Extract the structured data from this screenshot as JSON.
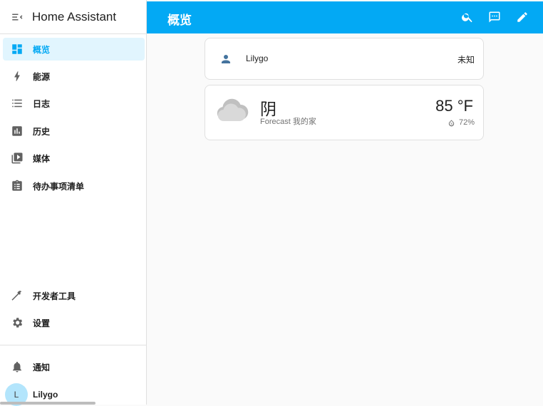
{
  "app": {
    "title": "Home Assistant"
  },
  "sidebar": {
    "items": [
      {
        "label": "概览",
        "icon": "dashboard-icon",
        "active": true
      },
      {
        "label": "能源",
        "icon": "lightning-bolt-icon"
      },
      {
        "label": "日志",
        "icon": "list-icon"
      },
      {
        "label": "历史",
        "icon": "chart-box-icon"
      },
      {
        "label": "媒体",
        "icon": "play-box-multiple-icon"
      },
      {
        "label": "待办事项清单",
        "icon": "clipboard-list-icon"
      }
    ],
    "bottom_items": [
      {
        "label": "开发者工具",
        "icon": "hammer-icon"
      },
      {
        "label": "设置",
        "icon": "cog-icon"
      }
    ],
    "notifications": {
      "label": "通知",
      "icon": "bell-icon"
    },
    "user": {
      "name": "Lilygo",
      "initial": "L"
    }
  },
  "header": {
    "title": "概览",
    "actions": [
      "search-icon",
      "assist-icon",
      "pencil-icon"
    ]
  },
  "cards": {
    "person": {
      "name": "Lilygo",
      "state": "未知",
      "icon": "account-icon"
    },
    "weather": {
      "condition": "阴",
      "subtitle": "Forecast 我的家",
      "temperature": "85 °F",
      "humidity": "72%",
      "icon": "cloud-icon"
    }
  },
  "colors": {
    "accent": "#03a9f4",
    "active_bg": "#e1f5fe",
    "icon": "#616161"
  }
}
